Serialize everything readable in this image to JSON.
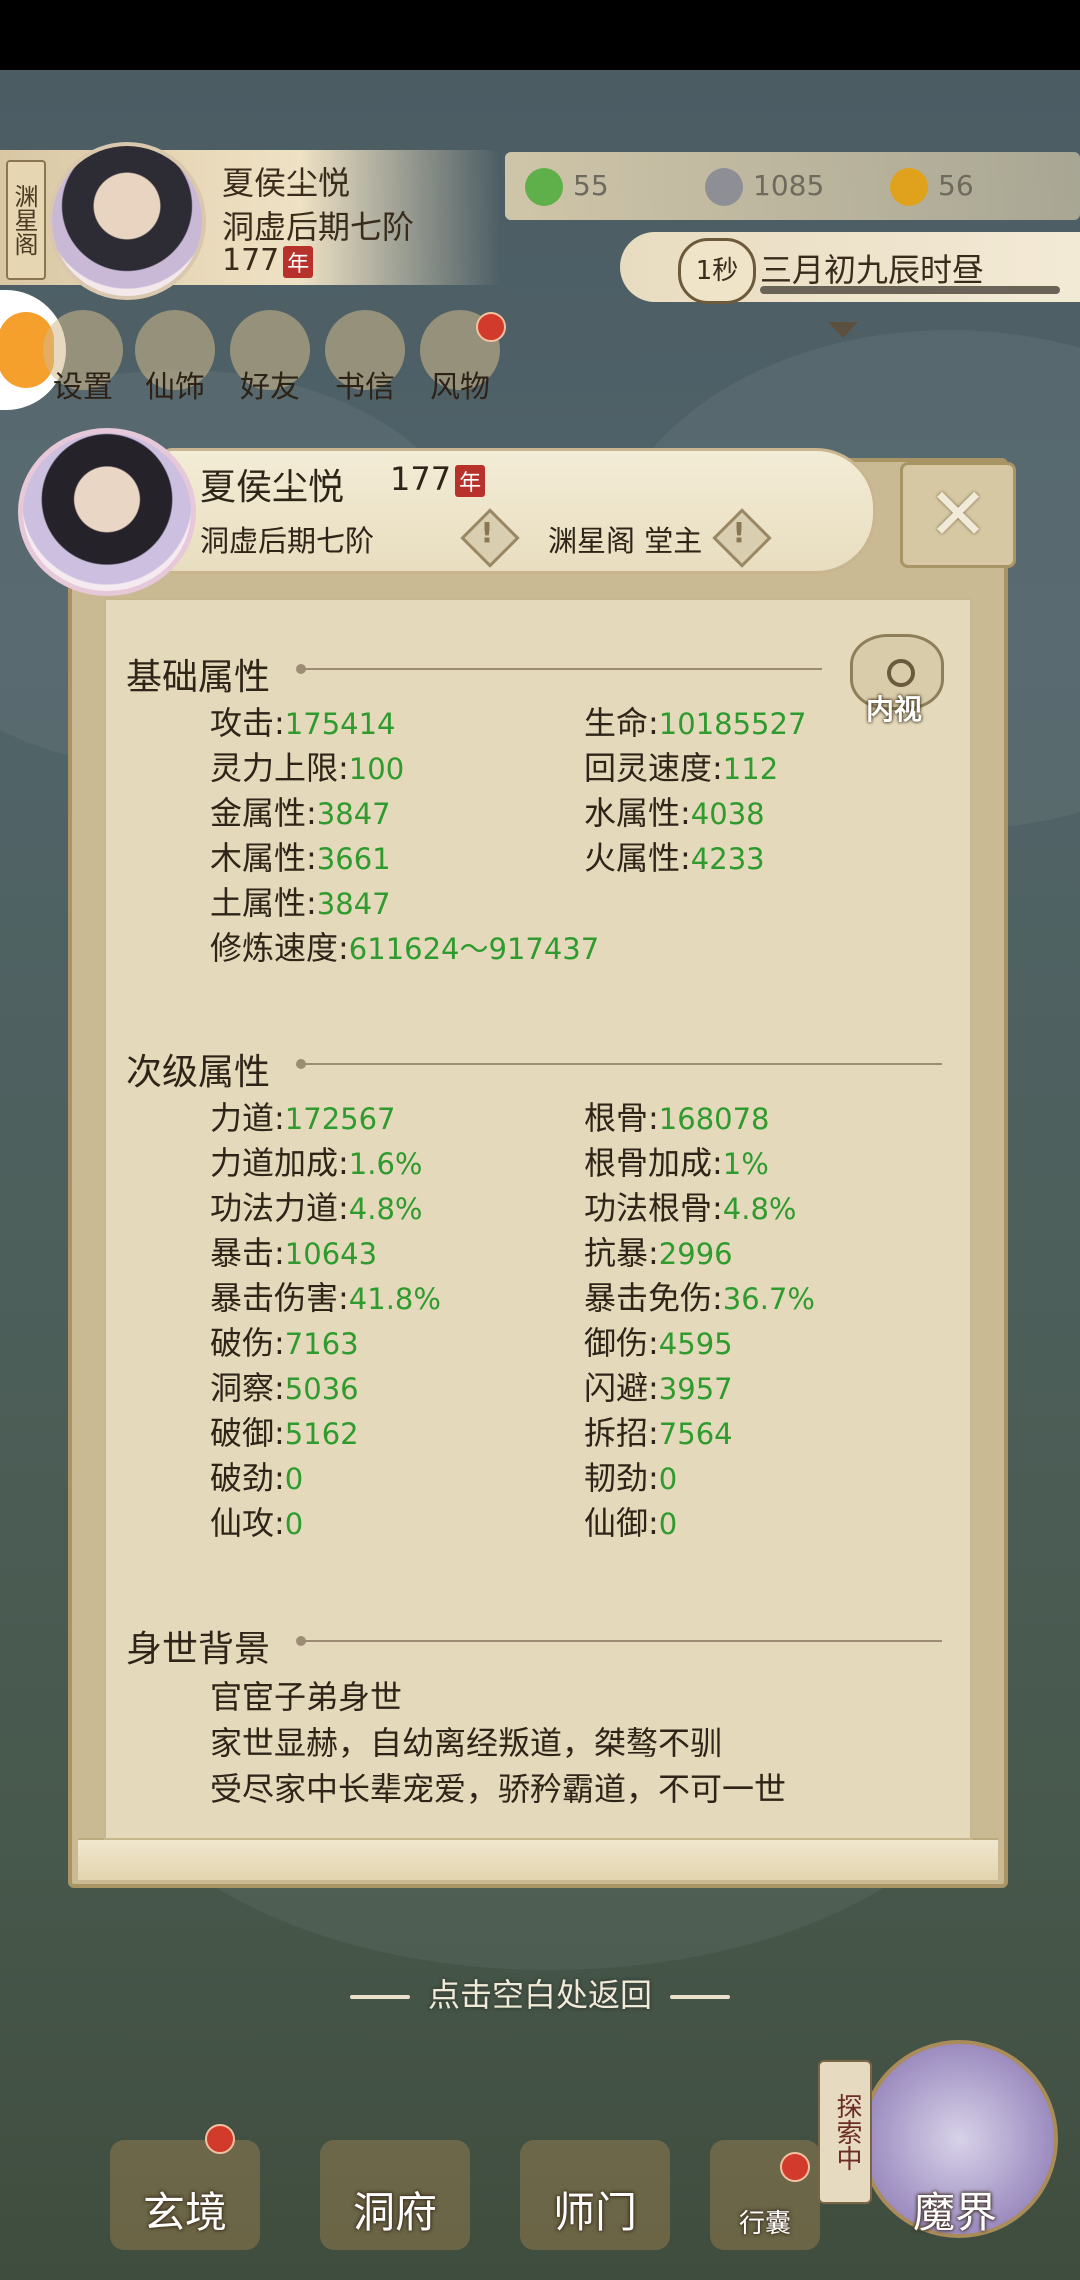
{
  "header": {
    "location": "渊星阁",
    "name": "夏侯尘悦",
    "realm": "洞虚后期七阶",
    "age": "177",
    "age_unit": "年"
  },
  "resources": [
    {
      "icon": "jade-leaf-icon",
      "value": "55",
      "color": "#5fb04a"
    },
    {
      "icon": "coin-icon",
      "value": "1085",
      "color": "#8d8f95"
    },
    {
      "icon": "gold-ingot-icon",
      "value": "56",
      "color": "#e0a21c"
    }
  ],
  "time": {
    "speed": "1秒",
    "text": "三月初九辰时昼"
  },
  "menu": [
    {
      "label": "设置",
      "icon": "settings-icon"
    },
    {
      "label": "仙饰",
      "icon": "costume-icon"
    },
    {
      "label": "好友",
      "icon": "friends-icon"
    },
    {
      "label": "书信",
      "icon": "letter-icon"
    },
    {
      "label": "风物",
      "icon": "scenery-icon"
    }
  ],
  "dialog": {
    "name": "夏侯尘悦",
    "age": "177",
    "age_unit": "年",
    "realm": "洞虚后期七阶",
    "sect": "渊星阁 堂主",
    "eye_label": "内视",
    "basic_title": "基础属性",
    "basic_stats": [
      {
        "label": "攻击",
        "value": "175414"
      },
      {
        "label": "生命",
        "value": "10185527"
      },
      {
        "label": "灵力上限",
        "value": "100"
      },
      {
        "label": "回灵速度",
        "value": "112"
      },
      {
        "label": "金属性",
        "value": "3847"
      },
      {
        "label": "水属性",
        "value": "4038"
      },
      {
        "label": "木属性",
        "value": "3661"
      },
      {
        "label": "火属性",
        "value": "4233"
      },
      {
        "label": "土属性",
        "value": "3847"
      },
      {
        "label": "修炼速度",
        "value": "611624～917437"
      }
    ],
    "secondary_title": "次级属性",
    "secondary_stats": [
      {
        "label": "力道",
        "value": "172567"
      },
      {
        "label": "根骨",
        "value": "168078"
      },
      {
        "label": "力道加成",
        "value": "1.6%"
      },
      {
        "label": "根骨加成",
        "value": "1%"
      },
      {
        "label": "功法力道",
        "value": "4.8%"
      },
      {
        "label": "功法根骨",
        "value": "4.8%"
      },
      {
        "label": "暴击",
        "value": "10643"
      },
      {
        "label": "抗暴",
        "value": "2996"
      },
      {
        "label": "暴击伤害",
        "value": "41.8%"
      },
      {
        "label": "暴击免伤",
        "value": "36.7%"
      },
      {
        "label": "破伤",
        "value": "7163"
      },
      {
        "label": "御伤",
        "value": "4595"
      },
      {
        "label": "洞察",
        "value": "5036"
      },
      {
        "label": "闪避",
        "value": "3957"
      },
      {
        "label": "破御",
        "value": "5162"
      },
      {
        "label": "拆招",
        "value": "7564"
      },
      {
        "label": "破劲",
        "value": "0"
      },
      {
        "label": "韧劲",
        "value": "0"
      },
      {
        "label": "仙攻",
        "value": "0"
      },
      {
        "label": "仙御",
        "value": "0"
      }
    ],
    "background_title": "身世背景",
    "background_lines": [
      "官宦子弟身世",
      "家世显赫，自幼离经叛道，桀骜不驯",
      "受尽家中长辈宠爱，骄矜霸道，不可一世"
    ]
  },
  "hint": "点击空白处返回",
  "nav": [
    {
      "label": "玄境"
    },
    {
      "label": "洞府"
    },
    {
      "label": "师门"
    },
    {
      "label": "行囊"
    },
    {
      "label": "魔界"
    }
  ],
  "explore_tag": "探索中"
}
